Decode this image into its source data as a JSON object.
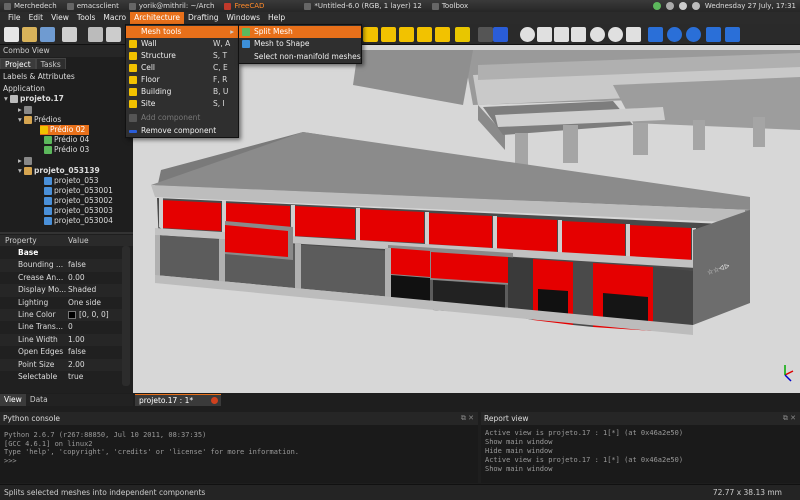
{
  "taskbar": {
    "tasks": [
      "Merchedech",
      "emacsclient",
      "yorik@mithril: ~/Arch",
      "FreeCAD",
      "*Untitled-6.0 (RGB, 1 layer) 12",
      "Toolbox"
    ],
    "datetime": "Wednesday 27 July, 17:31"
  },
  "menubar": {
    "items": [
      "File",
      "Edit",
      "View",
      "Tools",
      "Macro",
      "Architecture",
      "Drafting",
      "Windows",
      "Help"
    ]
  },
  "combo": {
    "title": "Combo View",
    "tabs": [
      "Project",
      "Tasks"
    ],
    "section": "Labels & Attributes",
    "application": "Application",
    "tree": [
      "projeto.17",
      "Prédios",
      "Prédio 02",
      "Prédio 04",
      "Prédio 03",
      "projeto_053139",
      "projeto_053",
      "projeto_053001",
      "projeto_053002",
      "projeto_053003",
      "projeto_053004"
    ]
  },
  "props": {
    "col_property": "Property",
    "col_value": "Value",
    "rows": [
      {
        "k": "Base",
        "v": ""
      },
      {
        "k": "Bounding ...",
        "v": "false"
      },
      {
        "k": "Crease An...",
        "v": "0.00"
      },
      {
        "k": "Display Mo...",
        "v": "Shaded"
      },
      {
        "k": "Lighting",
        "v": "One side"
      },
      {
        "k": "Line Color",
        "v": "[0, 0, 0]"
      },
      {
        "k": "Line Trans...",
        "v": "0"
      },
      {
        "k": "Line Width",
        "v": "1.00"
      },
      {
        "k": "Open Edges",
        "v": "false"
      },
      {
        "k": "Point Size",
        "v": "2.00"
      },
      {
        "k": "Selectable",
        "v": "true"
      }
    ]
  },
  "bottom_tabs": [
    "View",
    "Data"
  ],
  "doc_tab": "projeto.17 : 1*",
  "arch_menu": {
    "items": [
      {
        "label": "Mesh tools",
        "shortcut": ""
      },
      {
        "label": "Wall",
        "shortcut": "W, A"
      },
      {
        "label": "Structure",
        "shortcut": "S, T"
      },
      {
        "label": "Cell",
        "shortcut": "C, E"
      },
      {
        "label": "Floor",
        "shortcut": "F, R"
      },
      {
        "label": "Building",
        "shortcut": "B, U"
      },
      {
        "label": "Site",
        "shortcut": "S, I"
      },
      {
        "label": "Add component",
        "shortcut": ""
      },
      {
        "label": "Remove component",
        "shortcut": ""
      }
    ]
  },
  "mesh_menu": {
    "items": [
      "Split Mesh",
      "Mesh to Shape",
      "Select non-manifold meshes"
    ]
  },
  "python_console": {
    "title": "Python console",
    "lines": [
      "Python 2.6.7 (r267:88850, Jul 10 2011, 08:37:35)",
      "[GCC 4.6.1] on linux2",
      "Type 'help', 'copyright', 'credits' or 'license' for more information.",
      ">>>"
    ]
  },
  "report_view": {
    "title": "Report view",
    "lines": [
      "Active view is projeto.17 : 1[*] (at 0x46a2e50)",
      "Show main window",
      "Hide main window",
      "Active view is projeto.17 : 1[*] (at 0x46a2e50)",
      "Show main window"
    ]
  },
  "status": {
    "message": "Splits selected meshes into independent components",
    "dimensions": "72.77 x 38.13 mm"
  },
  "colors": {
    "accent": "#e8701a",
    "facade_red": "#e50000",
    "background": "#d9d9d9"
  }
}
